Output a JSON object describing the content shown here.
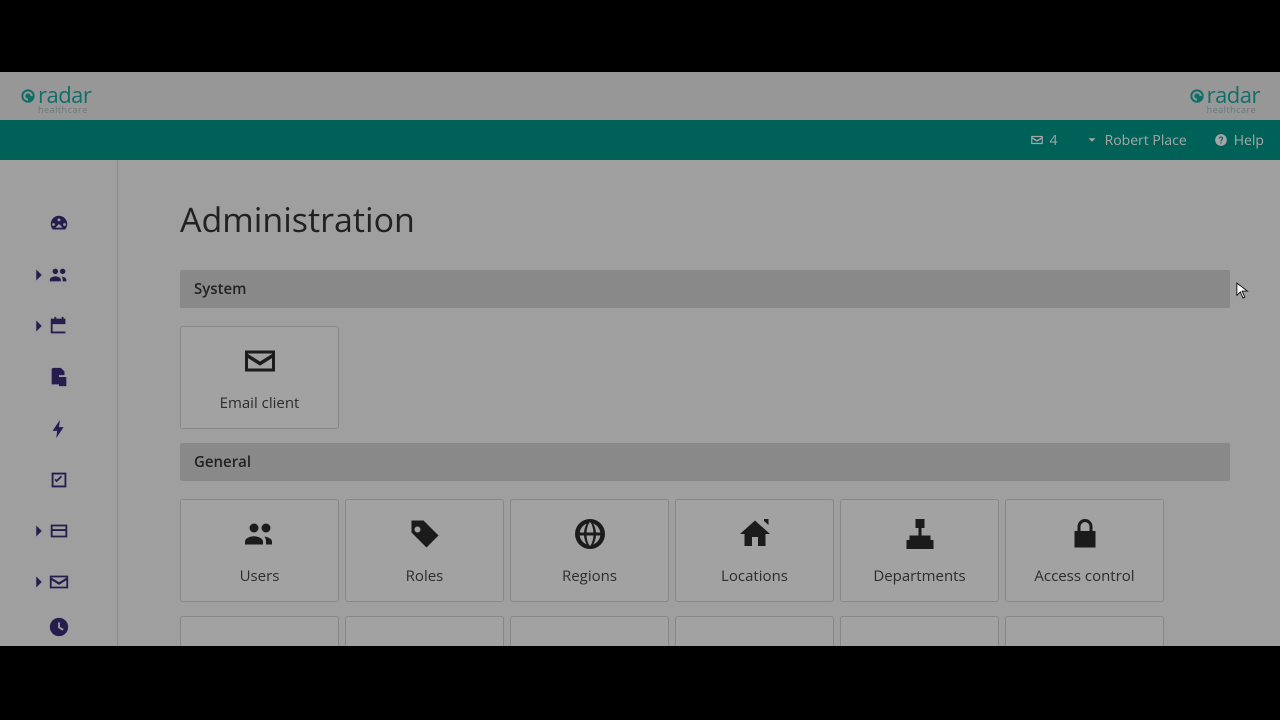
{
  "brand": {
    "name": "radar",
    "subtitle": "healthcare"
  },
  "nav": {
    "inbox_count": "4",
    "user_name": "Robert Place",
    "help_label": "Help"
  },
  "page": {
    "title": "Administration"
  },
  "sections": {
    "system": {
      "header": "System",
      "tiles": [
        {
          "label": "Email client",
          "icon": "envelope"
        }
      ]
    },
    "general": {
      "header": "General",
      "tiles_row1": [
        {
          "label": "Users",
          "icon": "users"
        },
        {
          "label": "Roles",
          "icon": "tag"
        },
        {
          "label": "Regions",
          "icon": "globe"
        },
        {
          "label": "Locations",
          "icon": "home"
        },
        {
          "label": "Departments",
          "icon": "sitemap"
        },
        {
          "label": "Access control",
          "icon": "lock"
        }
      ]
    }
  }
}
